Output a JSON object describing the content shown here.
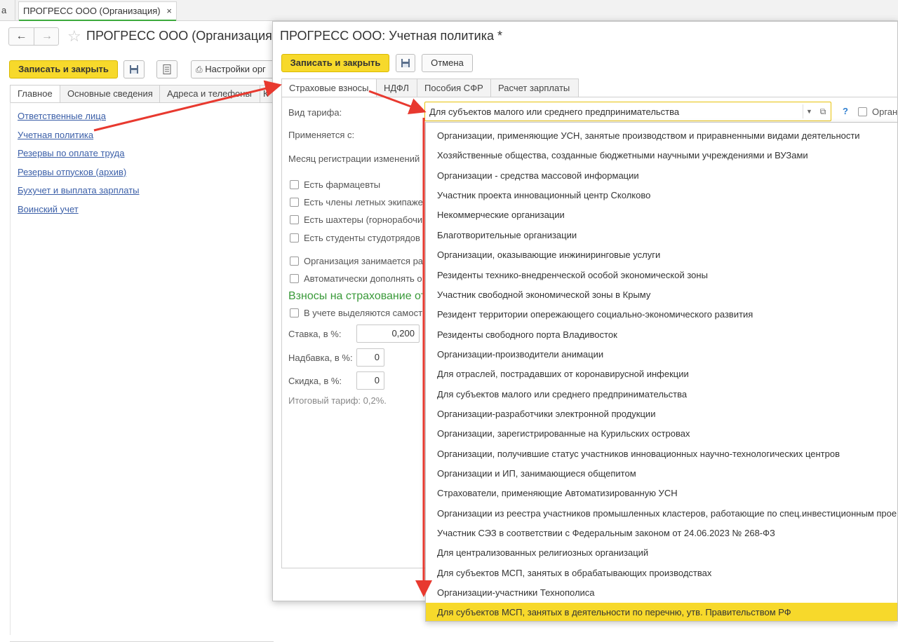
{
  "tabstrip": {
    "prev_tab_label": "а",
    "active_tab_label": "ПРОГРЕСС ООО (Организация)",
    "close_glyph": "×"
  },
  "org_form": {
    "title": "ПРОГРЕСС ООО (Организация)",
    "save_close_label": "Записать и закрыть",
    "settings_label": "Настройки орг",
    "tabs": [
      "Главное",
      "Основные сведения",
      "Адреса и телефоны",
      "К"
    ],
    "links": [
      "Ответственные лица",
      "Учетная политика",
      "Резервы по оплате труда",
      "Резервы отпусков (архив)",
      "Бухучет и выплата зарплаты",
      "Воинский учет"
    ]
  },
  "modal": {
    "title": "ПРОГРЕСС ООО: Учетная политика *",
    "save_close_label": "Записать и закрыть",
    "cancel_label": "Отмена",
    "tabs": [
      "Страховые взносы",
      "НДФЛ",
      "Пособия СФР",
      "Расчет зарплаты"
    ],
    "tariff_label": "Вид тарифа:",
    "tariff_value": "Для субъектов малого или среднего предпринимательства",
    "help_glyph": "?",
    "org_checkbox_label": "Организ",
    "applies_label": "Применяется с:",
    "month_label": "Месяц регистрации изменений",
    "checkboxes": [
      "Есть фармацевты",
      "Есть члены летных экипаже",
      "Есть шахтеры (горнорабочи",
      "Есть студенты студотрядов",
      "Организация занимается ра",
      "Автоматически дополнять о"
    ],
    "section_title": "Взносы на страхование от",
    "separate_checkbox": "В учете выделяются самост",
    "rate_label": "Ставка, в %:",
    "rate_value": "0,200",
    "surcharge_label": "Надбавка, в %:",
    "surcharge_value": "0",
    "discount_label": "Скидка, в %:",
    "discount_value": "0",
    "total_text": "Итоговый тариф: 0,2%."
  },
  "dropdown": {
    "selected_index": 24,
    "items": [
      "Организации, применяющие УСН, занятые производством и приравненными видами деятельности",
      "Хозяйственные общества, созданные бюджетными научными учреждениями и ВУЗами",
      "Организации - средства массовой информации",
      "Участник проекта инновационный центр Сколково",
      "Некоммерческие организации",
      "Благотворительные организации",
      "Организации, оказывающие инжиниринговые услуги",
      "Резиденты технико-внедренческой особой экономической зоны",
      "Участник свободной экономической зоны в Крыму",
      "Резидент территории опережающего социально-экономического развития",
      "Резиденты свободного порта Владивосток",
      "Организации-производители анимации",
      "Для отраслей, пострадавших от коронавирусной инфекции",
      "Для субъектов малого или среднего предпринимательства",
      "Организации-разработчики электронной продукции",
      "Организации, зарегистрированные на Курильских островах",
      "Организации, получившие статус участников инновационных научно-технологических центров",
      "Организации и ИП, занимающиеся общепитом",
      "Страхователи, применяющие Автоматизированную УСН",
      "Организации из реестра участников промышленных кластеров, работающие по спец.инвестиционным прое",
      "Участник СЭЗ в соответствии с Федеральным законом от 24.06.2023 № 268-ФЗ",
      "Для централизованных религиозных организаций",
      "Для субъектов МСП, занятых в обрабатывающих производствах",
      "Организации-участники Технополиса",
      "Для субъектов МСП, занятых в деятельности по перечню, утв. Правительством РФ"
    ]
  },
  "colors": {
    "accent_yellow": "#f7d92b",
    "link_blue": "#3b5fa8",
    "section_green": "#3a9a3a",
    "arrow_red": "#e8392f",
    "tab_underline_green": "#3caa3c"
  }
}
